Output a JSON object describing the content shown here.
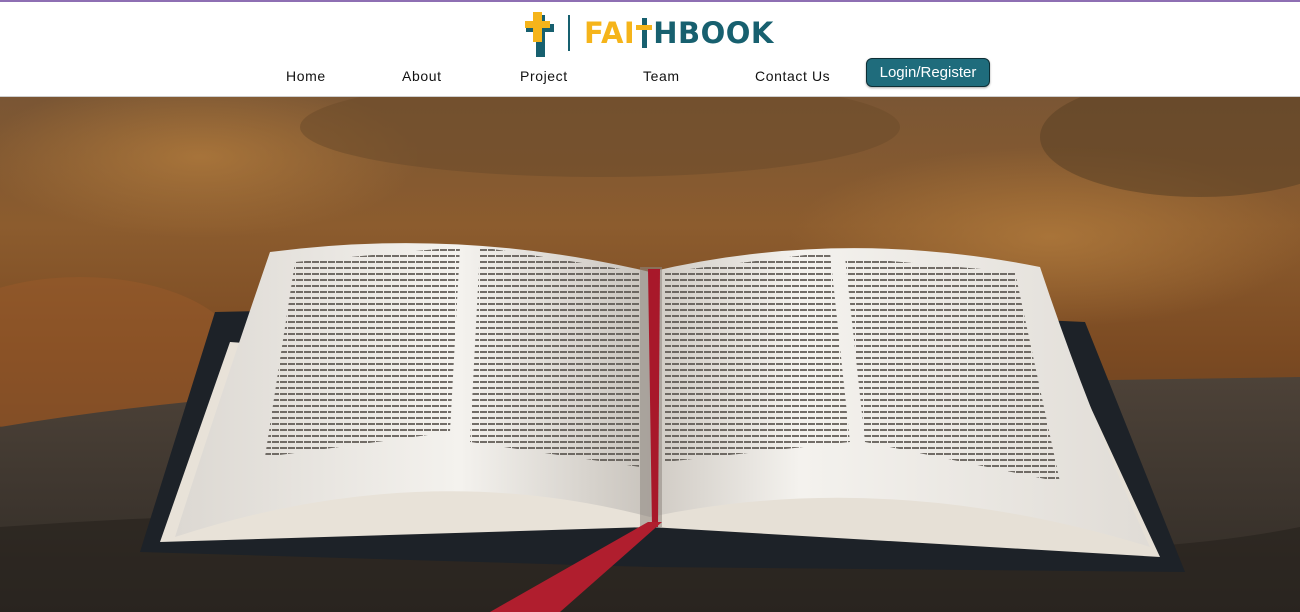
{
  "brand": {
    "name_part1": "FAI",
    "name_part2": "H",
    "name_part3": "BOOK",
    "logo_icon": "cross-icon",
    "colors": {
      "gold": "#f5b41a",
      "teal": "#17606f"
    }
  },
  "nav": {
    "items": [
      {
        "label": "Home"
      },
      {
        "label": "About"
      },
      {
        "label": "Project"
      },
      {
        "label": "Team"
      },
      {
        "label": "Contact Us"
      }
    ],
    "login_label": "Login/Register"
  },
  "hero": {
    "image": "open-bible-on-stone"
  }
}
